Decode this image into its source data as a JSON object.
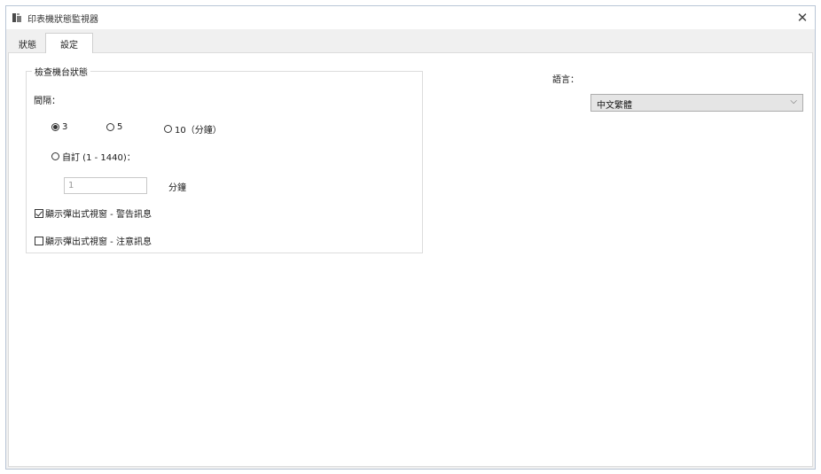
{
  "window": {
    "title": "印表機狀態監視器",
    "close_glyph": "✕"
  },
  "tabs": [
    {
      "label": "狀態"
    },
    {
      "label": "設定"
    }
  ],
  "check_group": {
    "title": "檢查機台狀態",
    "interval_label": "間隔：",
    "radios": [
      {
        "label": "3",
        "checked": true
      },
      {
        "label": "5",
        "checked": false
      },
      {
        "label": "10（分鐘）",
        "checked": false
      }
    ],
    "custom_radio": {
      "label": "自訂 (1 - 1440)：",
      "checked": false
    },
    "custom_value": "1",
    "minutes_label": "分鐘"
  },
  "checkboxes": [
    {
      "label": "顯示彈出式視窗 - 警告訊息",
      "checked": true
    },
    {
      "label": "顯示彈出式視窗 - 注意訊息",
      "checked": false
    }
  ],
  "language": {
    "label": "語言：",
    "selected": "中文繁體",
    "arrow_glyph": "⌵"
  }
}
